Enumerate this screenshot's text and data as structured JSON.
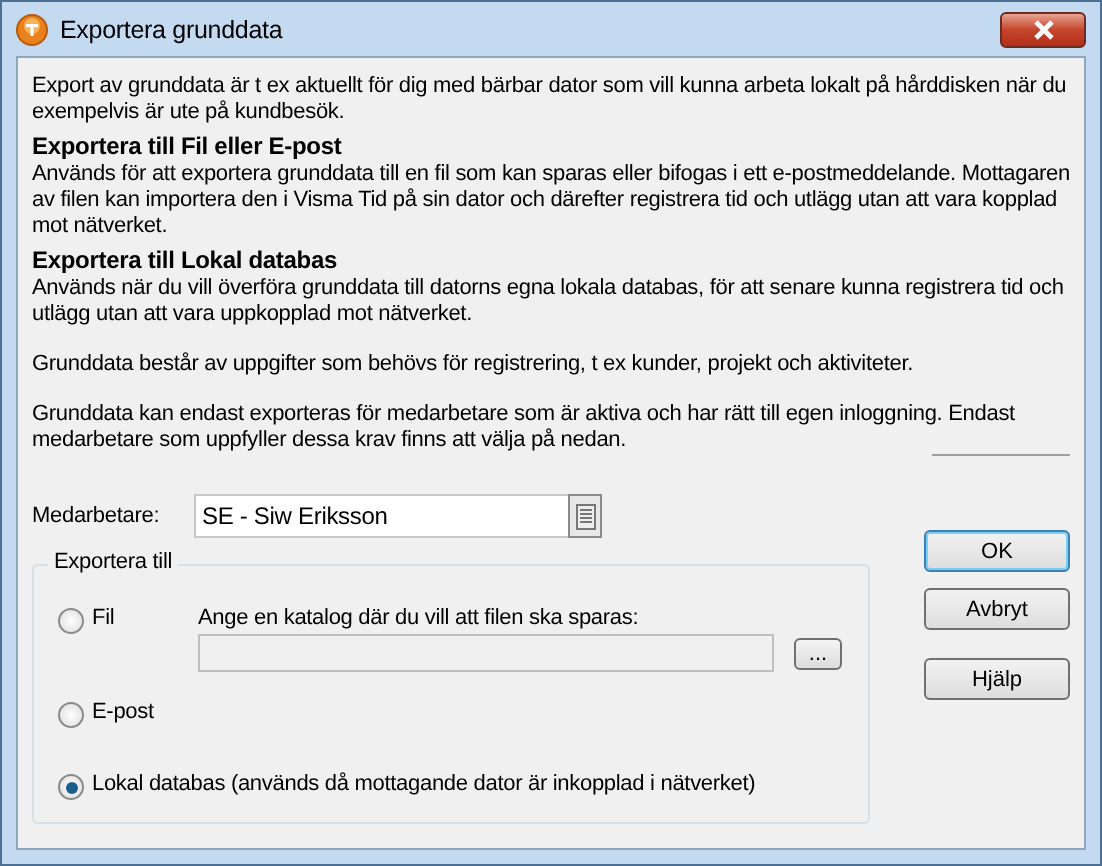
{
  "window": {
    "title": "Exportera grunddata"
  },
  "paragraphs": [
    {
      "kind": "text",
      "text": "Export av grunddata är t ex aktuellt för dig med bärbar dator som vill kunna arbeta lokalt på hårddisken när du exempelvis är ute på kundbesök."
    },
    {
      "kind": "heading",
      "text": "Exportera till Fil eller E-post"
    },
    {
      "kind": "text",
      "text": "Används för att exportera grunddata till en fil som kan sparas eller bifogas i ett e-postmeddelande. Mottagaren av filen kan importera den i Visma Tid på sin dator och därefter registrera tid och utlägg utan att vara kopplad mot nätverket."
    },
    {
      "kind": "heading",
      "text": "Exportera till Lokal databas"
    },
    {
      "kind": "text",
      "text": "Används när du vill överföra grunddata till datorns egna  lokala databas, för att senare kunna registrera tid och utlägg utan att vara uppkopplad mot nätverket."
    },
    {
      "kind": "text",
      "text": "Grunddata består av uppgifter som behövs för registrering, t ex kunder, projekt och aktiviteter."
    },
    {
      "kind": "text",
      "text": "Grunddata kan endast exporteras för medarbetare som är aktiva och har rätt till egen inloggning. Endast medarbetare som uppfyller dessa krav finns att välja på nedan."
    }
  ],
  "employee": {
    "label": "Medarbetare:",
    "value": "SE - Siw Eriksson"
  },
  "export": {
    "title": "Exportera till",
    "options": [
      {
        "label": "Fil",
        "selected": false
      },
      {
        "label": "E-post",
        "selected": false
      },
      {
        "label": "Lokal databas (används då mottagande dator är inkopplad i nätverket)",
        "selected": true
      }
    ],
    "directory": {
      "label": "Ange en katalog där du vill att filen ska sparas:",
      "disabled": true,
      "browse": "..."
    }
  },
  "buttons": [
    {
      "label": "OK",
      "default": true
    },
    {
      "label": "Avbryt",
      "default": false
    },
    {
      "label": "Hjälp",
      "default": false
    }
  ]
}
